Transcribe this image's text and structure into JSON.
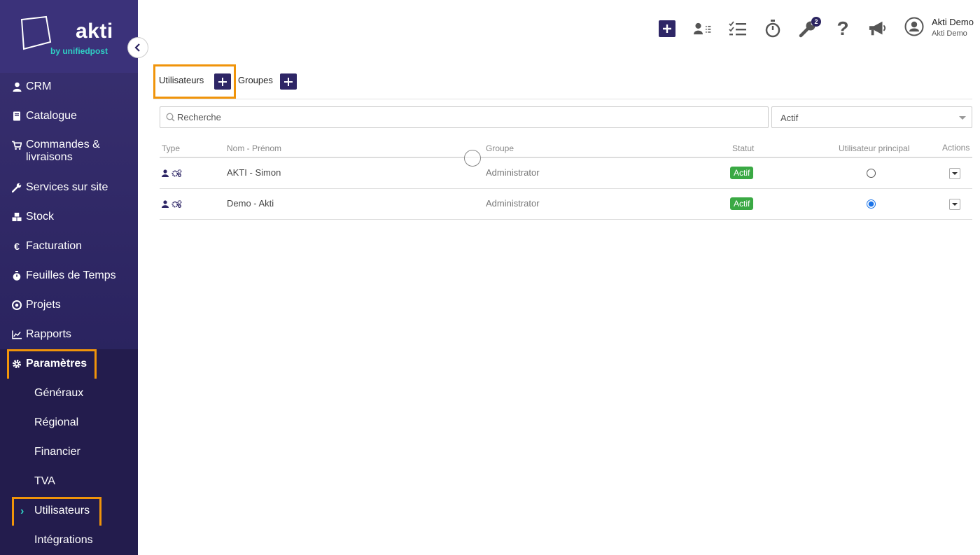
{
  "brand": {
    "name": "akti",
    "tagline": "by unifiedpost"
  },
  "sidebar": {
    "items": [
      {
        "label": "CRM",
        "icon": "user-icon"
      },
      {
        "label": "Catalogue",
        "icon": "book-icon"
      },
      {
        "label": "Commandes & livraisons",
        "icon": "cart-icon"
      },
      {
        "label": "Services sur site",
        "icon": "wrench-icon"
      },
      {
        "label": "Stock",
        "icon": "boxes-icon"
      },
      {
        "label": "Facturation",
        "icon": "euro-icon"
      },
      {
        "label": "Feuilles de Temps",
        "icon": "stopwatch-icon"
      },
      {
        "label": "Projets",
        "icon": "target-icon"
      },
      {
        "label": "Rapports",
        "icon": "chart-icon"
      },
      {
        "label": "Paramètres",
        "icon": "gear-icon"
      }
    ],
    "subitems": [
      {
        "label": "Généraux"
      },
      {
        "label": "Régional"
      },
      {
        "label": "Financier"
      },
      {
        "label": "TVA"
      },
      {
        "label": "Utilisateurs"
      },
      {
        "label": "Intégrations"
      }
    ]
  },
  "topbar": {
    "notification_count": "2",
    "user_name": "Akti Demo",
    "user_company": "Akti Demo"
  },
  "tabs": {
    "users": "Utilisateurs",
    "groups": "Groupes"
  },
  "filters": {
    "search_placeholder": "Recherche",
    "status_selected": "Actif"
  },
  "table": {
    "headers": {
      "type": "Type",
      "name": "Nom - Prénom",
      "group": "Groupe",
      "status": "Statut",
      "main_user": "Utilisateur principal",
      "actions": "Actions"
    },
    "rows": [
      {
        "name": "AKTI - Simon",
        "group": "Administrator",
        "status": "Actif",
        "main_user": false
      },
      {
        "name": "Demo - Akti",
        "group": "Administrator",
        "status": "Actif",
        "main_user": true
      }
    ]
  },
  "colors": {
    "sidebar": "#2b2460",
    "accent": "#2e2666",
    "teal": "#2fd0c4",
    "highlight": "#f0940a",
    "status_active": "#3aa944"
  }
}
